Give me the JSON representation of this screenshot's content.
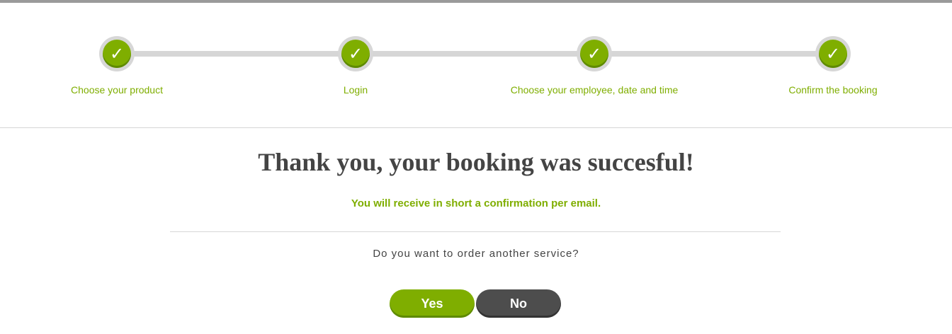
{
  "colors": {
    "accent": "#7fae00",
    "accent_dark": "#5e8a00",
    "text_dark": "#444444",
    "line": "#d6d6d6",
    "no_button": "#4d4d4d"
  },
  "steps": [
    {
      "label": "Choose your product",
      "icon": "check-icon",
      "glyph": "✓",
      "status": "completed"
    },
    {
      "label": "Login",
      "icon": "check-icon",
      "glyph": "✓",
      "status": "completed"
    },
    {
      "label": "Choose your employee, date and time",
      "icon": "check-icon",
      "glyph": "✓",
      "status": "completed"
    },
    {
      "label": "Confirm the booking",
      "icon": "check-icon",
      "glyph": "✓",
      "status": "completed"
    }
  ],
  "confirmation": {
    "heading": "Thank you, your booking was succesful!",
    "subtext": "You will receive in short a confirmation per email.",
    "question": "Do you want to order another service?"
  },
  "buttons": {
    "yes": "Yes",
    "no": "No"
  }
}
